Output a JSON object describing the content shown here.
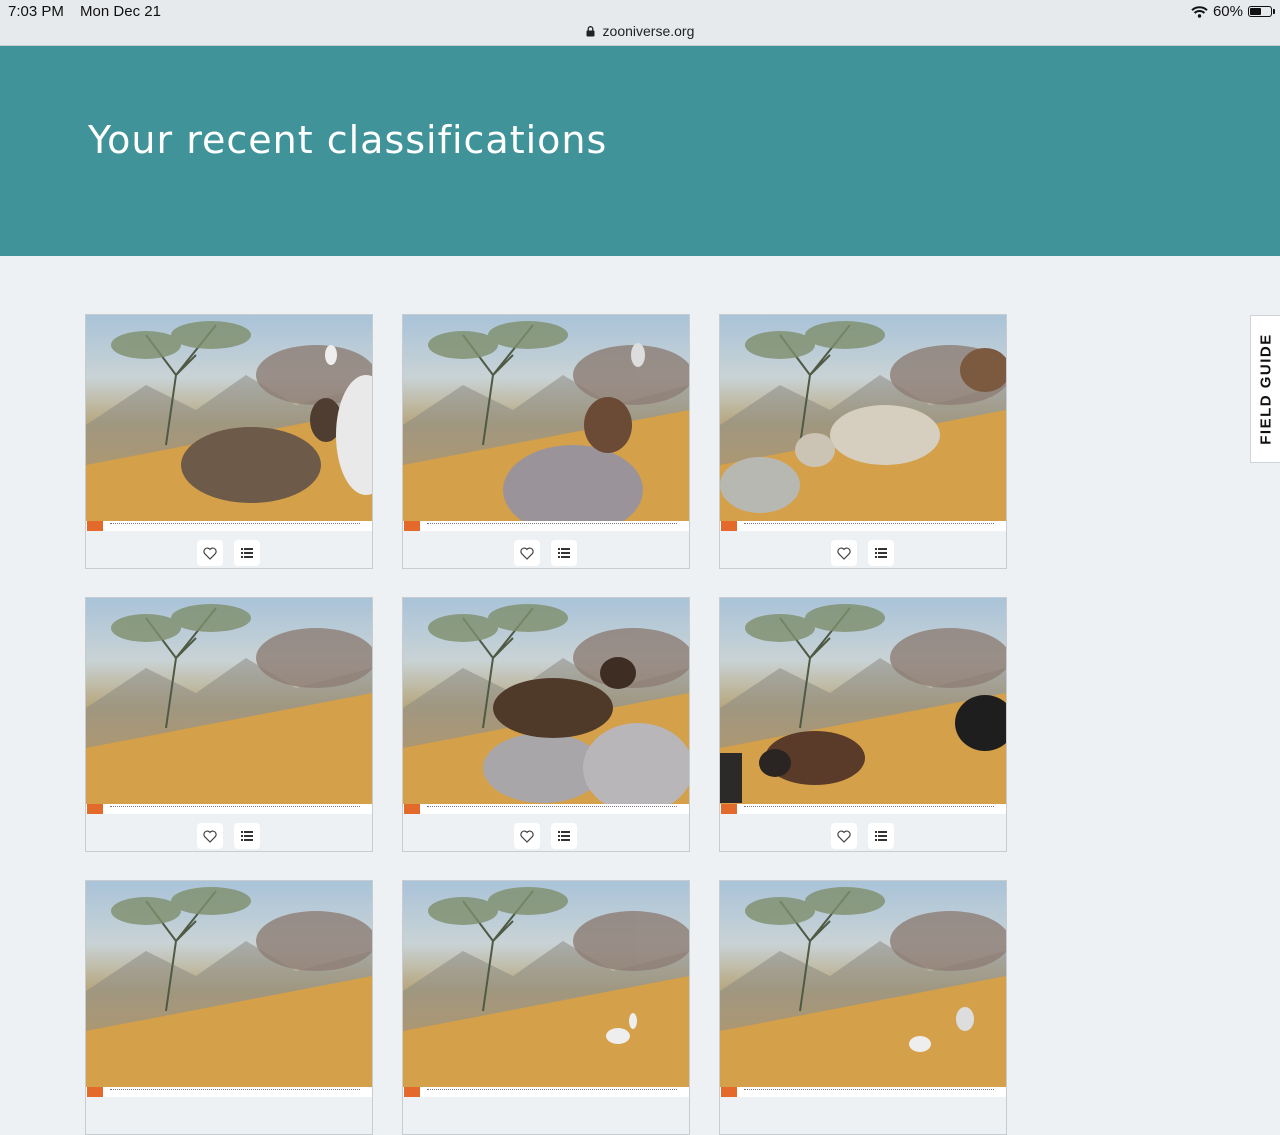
{
  "status_bar": {
    "time": "7:03 PM",
    "date": "Mon Dec 21",
    "url": "zooniverse.org",
    "battery": "60%",
    "battery_level": 0.6
  },
  "hero": {
    "title": "Your recent classifications"
  },
  "side_tab": {
    "label": "FIELD GUIDE"
  },
  "colors": {
    "hero_bg": "#3f9399",
    "page_bg": "#eef1f4",
    "card_border": "#c7ccd1"
  },
  "cards": [
    {
      "subject": "goat, white goats, tree",
      "actions": [
        "heart-icon",
        "list-icon"
      ]
    },
    {
      "subject": "goat with lying animal",
      "actions": [
        "heart-icon",
        "list-icon"
      ]
    },
    {
      "subject": "white cattle",
      "actions": [
        "heart-icon",
        "list-icon"
      ]
    },
    {
      "subject": "empty hillside",
      "actions": [
        "heart-icon",
        "list-icon"
      ]
    },
    {
      "subject": "brown goat close-up",
      "actions": [
        "heart-icon",
        "list-icon"
      ]
    },
    {
      "subject": "brown cattle",
      "actions": [
        "heart-icon",
        "list-icon"
      ]
    },
    {
      "subject": "hillside",
      "actions": []
    },
    {
      "subject": "white goats",
      "actions": []
    },
    {
      "subject": "white goats",
      "actions": []
    }
  ]
}
